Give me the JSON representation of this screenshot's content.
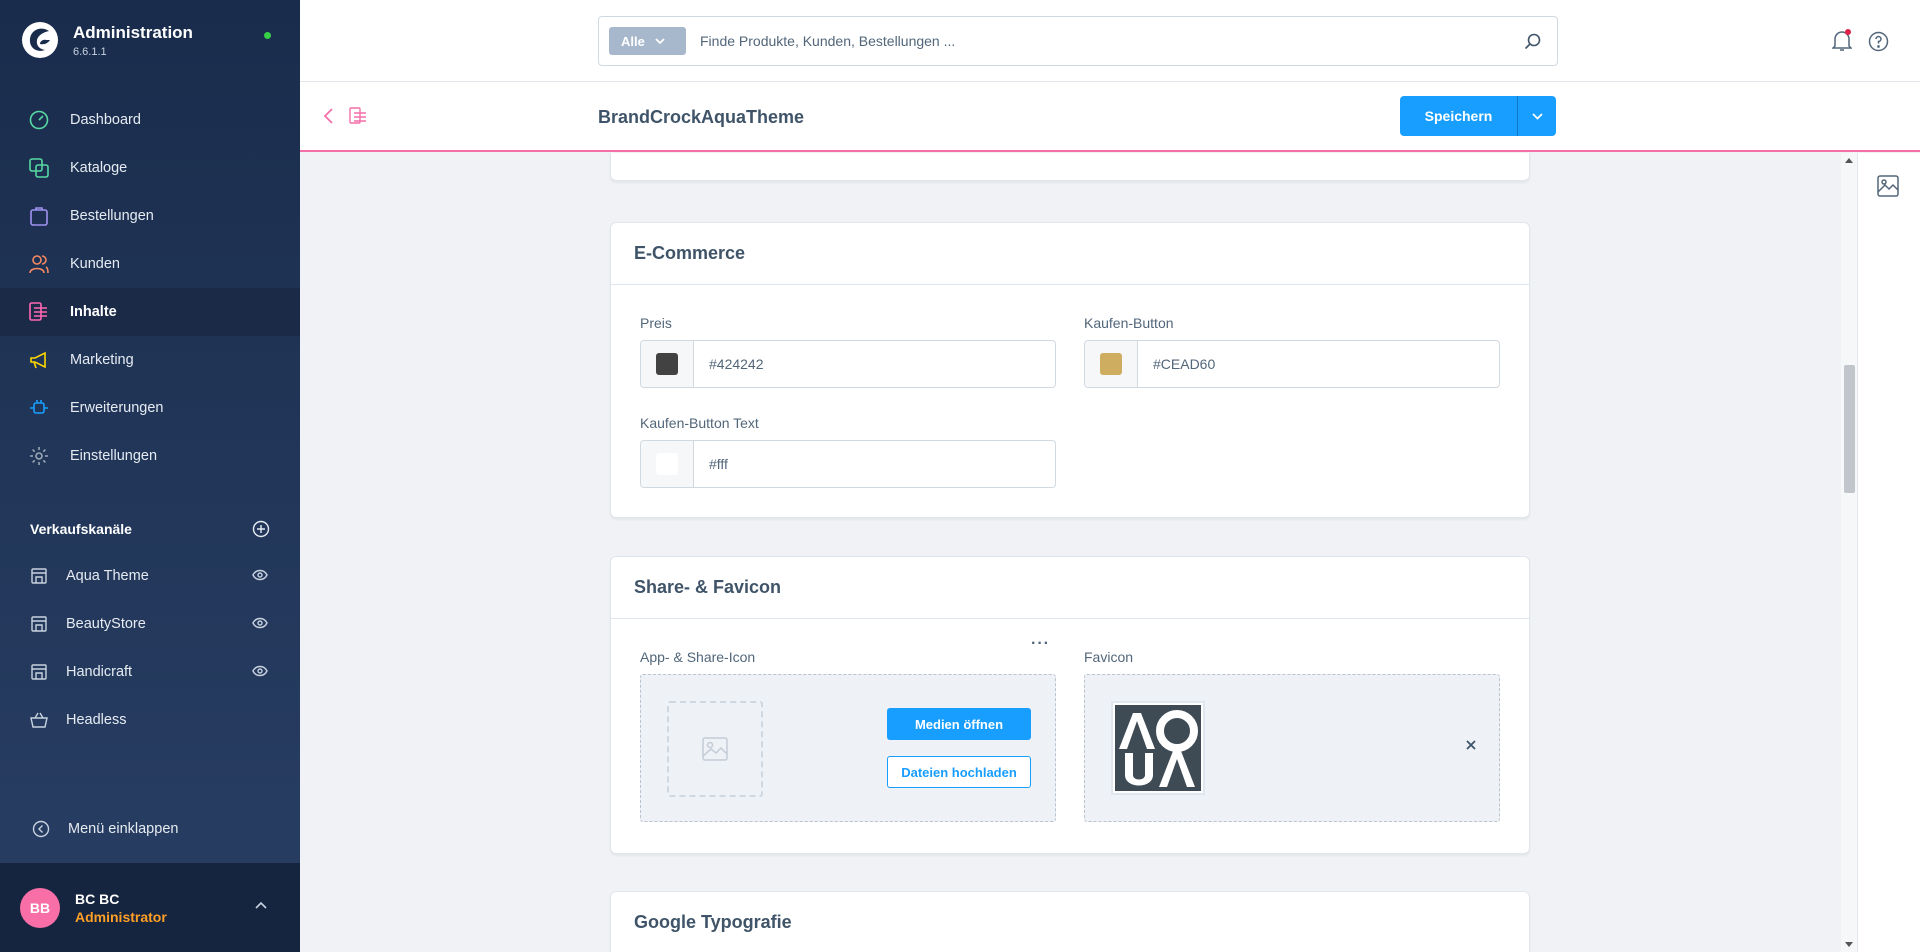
{
  "app": {
    "title": "Administration",
    "version": "6.6.1.1"
  },
  "nav": [
    {
      "label": "Dashboard",
      "icon": "dashboard-icon",
      "color": "#57d9a3"
    },
    {
      "label": "Kataloge",
      "icon": "catalog-icon",
      "color": "#57d9a3"
    },
    {
      "label": "Bestellungen",
      "icon": "orders-icon",
      "color": "#a092f0"
    },
    {
      "label": "Kunden",
      "icon": "customers-icon",
      "color": "#f88962"
    },
    {
      "label": "Inhalte",
      "icon": "content-icon",
      "color": "#ff68b4",
      "active": true
    },
    {
      "label": "Marketing",
      "icon": "marketing-icon",
      "color": "#ffd700"
    },
    {
      "label": "Erweiterungen",
      "icon": "extensions-icon",
      "color": "#189eff"
    },
    {
      "label": "Einstellungen",
      "icon": "settings-icon",
      "color": "#9aa8b5"
    }
  ],
  "sales_channels": {
    "title": "Verkaufskanäle",
    "items": [
      {
        "label": "Aqua Theme",
        "visible_icon": true
      },
      {
        "label": "BeautyStore",
        "visible_icon": true
      },
      {
        "label": "Handicraft",
        "visible_icon": true
      },
      {
        "label": "Headless",
        "visible_icon": false
      }
    ]
  },
  "collapse_label": "Menü einklappen",
  "user": {
    "initials": "BB",
    "name": "BC BC",
    "role": "Administrator"
  },
  "search": {
    "type_label": "Alle",
    "placeholder": "Finde Produkte, Kunden, Bestellungen ..."
  },
  "smartbar": {
    "title": "BrandCrockAquaTheme",
    "save_label": "Speichern"
  },
  "ecommerce": {
    "title": "E-Commerce",
    "fields": [
      {
        "label": "Preis",
        "value": "#424242",
        "swatch": "#424242"
      },
      {
        "label": "Kaufen-Button",
        "value": "#CEAD60",
        "swatch": "#CEAD60"
      },
      {
        "label": "Kaufen-Button Text",
        "value": "#fff",
        "swatch": "#ffffff"
      }
    ]
  },
  "share_favicon": {
    "title": "Share- & Favicon",
    "app_icon": {
      "label": "App- & Share-Icon",
      "open_media": "Medien öffnen",
      "upload": "Dateien hochladen"
    },
    "favicon": {
      "label": "Favicon"
    }
  },
  "typography": {
    "title": "Google Typografie"
  },
  "colors": {
    "accent": "#189eff",
    "highlight": "#f46fa8",
    "sidebar": "#1a2c4c"
  }
}
